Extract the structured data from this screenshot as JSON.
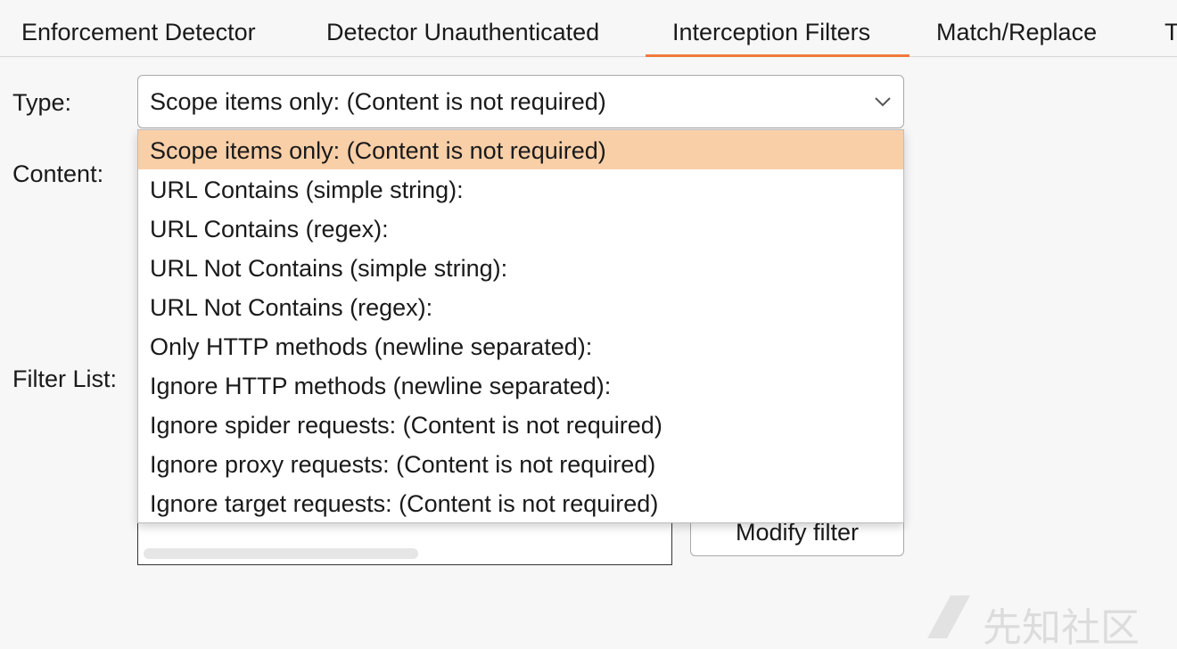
{
  "tabs": [
    {
      "label": "Enforcement Detector",
      "active": false
    },
    {
      "label": "Detector Unauthenticated",
      "active": false
    },
    {
      "label": "Interception Filters",
      "active": true
    },
    {
      "label": "Match/Replace",
      "active": false
    },
    {
      "label": "T",
      "active": false
    }
  ],
  "form": {
    "type_label": "Type:",
    "content_label": "Content:",
    "filter_list_label": "Filter List:"
  },
  "type_select": {
    "value": "Scope items only: (Content is not required)",
    "options": [
      "Scope items only: (Content is not required)",
      "URL Contains (simple string):",
      "URL Contains (regex):",
      "URL Not Contains (simple string):",
      "URL Not Contains (regex):",
      "Only HTTP methods (newline separated):",
      "Ignore HTTP methods (newline separated):",
      "Ignore spider requests: (Content is not required)",
      "Ignore proxy requests: (Content is not required)",
      "Ignore target requests: (Content is not required)"
    ],
    "selected_index": 0
  },
  "buttons": {
    "modify_filter": "Modify filter"
  },
  "watermark": {
    "text": "先知社区"
  },
  "colors": {
    "accent": "#f07a3d",
    "selected_option": "#f9cfa8"
  }
}
